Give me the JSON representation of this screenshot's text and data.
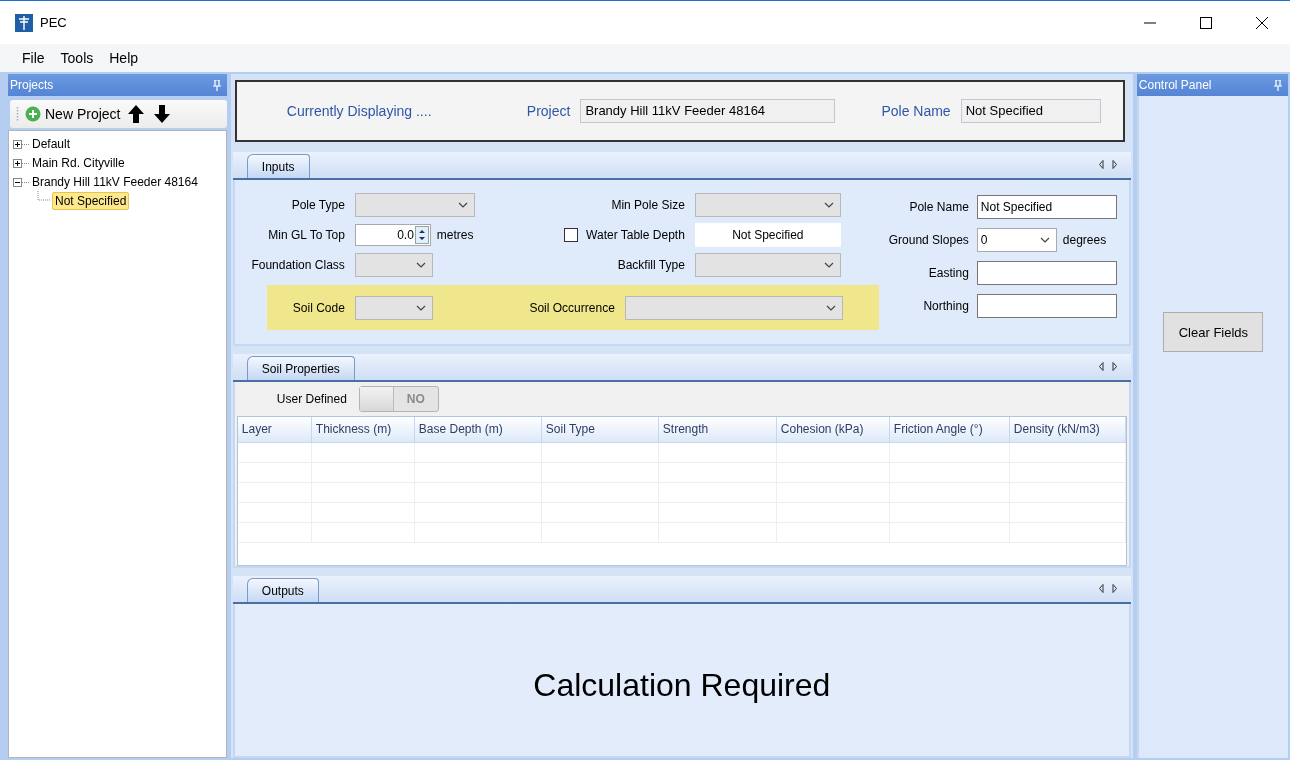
{
  "window": {
    "title": "PEC"
  },
  "menu": [
    {
      "label": "File"
    },
    {
      "label": "Tools"
    },
    {
      "label": "Help"
    }
  ],
  "projects_panel": {
    "title": "Projects",
    "new_button": "New Project",
    "tree": [
      {
        "label": "Default",
        "expanded": false,
        "selected": false
      },
      {
        "label": "Main Rd. Cityville",
        "expanded": false,
        "selected": false
      },
      {
        "label": "Brandy Hill 11kV Feeder 48164",
        "expanded": true,
        "selected": false,
        "children": [
          {
            "label": "Not Specified",
            "selected": true
          }
        ]
      }
    ]
  },
  "header": {
    "caption": "Currently Displaying ....",
    "project_label": "Project",
    "project_value": "Brandy Hill 11kV Feeder 48164",
    "pole_label": "Pole Name",
    "pole_value": "Not Specified"
  },
  "inputs": {
    "tab": "Inputs",
    "rows": [
      {
        "left": {
          "label": "Pole Type",
          "kind": "combo",
          "disabled": true
        },
        "middle": {
          "label": "Min Pole Size",
          "kind": "combo",
          "disabled": true
        }
      },
      {
        "left": {
          "label": "Min GL To Top",
          "kind": "spin",
          "value": "0.0",
          "unit": "metres"
        },
        "middle": {
          "label": "Water Table Depth",
          "kind": "check",
          "checked": false,
          "value": "Not Specified"
        }
      },
      {
        "left": {
          "label": "Foundation Class",
          "kind": "combo",
          "disabled": true
        },
        "middle": {
          "label": "Backfill Type",
          "kind": "combo",
          "disabled": true
        }
      }
    ],
    "soil_row": {
      "left": {
        "label": "Soil Code",
        "kind": "combo",
        "disabled": true
      },
      "middle": {
        "label": "Soil Occurrence",
        "kind": "combo",
        "disabled": true
      }
    },
    "right": [
      {
        "label": "Pole Name",
        "kind": "text",
        "value": "Not Specified"
      },
      {
        "label": "Ground Slopes",
        "kind": "combo",
        "disabled": false,
        "value": "0",
        "unit": "degrees"
      },
      {
        "label": "Easting",
        "kind": "text"
      },
      {
        "label": "Northing",
        "kind": "text"
      }
    ]
  },
  "soil_properties": {
    "tab": "Soil Properties",
    "user_defined": {
      "label": "User Defined",
      "on": false,
      "state_text": "NO"
    },
    "columns": [
      "Layer",
      "Thickness (m)",
      "Base Depth (m)",
      "Soil Type",
      "Strength",
      "Cohesion (kPa)",
      "Friction Angle (°)",
      "Density (kN/m3)"
    ]
  },
  "outputs": {
    "tab": "Outputs",
    "message": "Calculation Required"
  },
  "control_panel": {
    "title": "Control Panel",
    "button": "Clear Fields"
  }
}
